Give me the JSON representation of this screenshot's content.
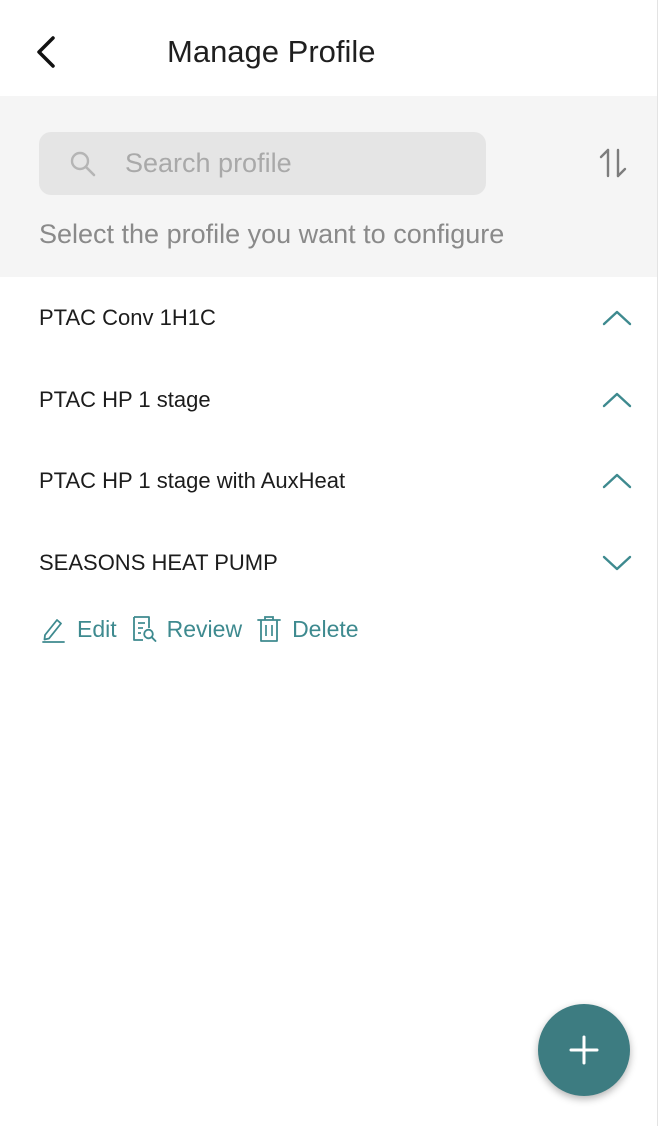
{
  "header": {
    "title": "Manage Profile"
  },
  "search": {
    "placeholder": "Search profile"
  },
  "hint": "Select the profile you want to configure",
  "profiles": [
    {
      "name": "PTAC Conv 1H1C",
      "chevron": "chevron-up-icon"
    },
    {
      "name": "PTAC HP 1 stage",
      "chevron": "chevron-up-icon"
    },
    {
      "name": "PTAC HP 1 stage with AuxHeat",
      "chevron": "chevron-up-icon"
    },
    {
      "name": "SEASONS HEAT PUMP",
      "chevron": "chevron-down-icon"
    }
  ],
  "actions": {
    "edit": "Edit",
    "review": "Review",
    "delete": "Delete"
  },
  "colors": {
    "accent": "#3e8a8f",
    "fab": "#3d7c81",
    "search_bg": "#e5e5e5",
    "section_bg": "#f5f5f5"
  }
}
